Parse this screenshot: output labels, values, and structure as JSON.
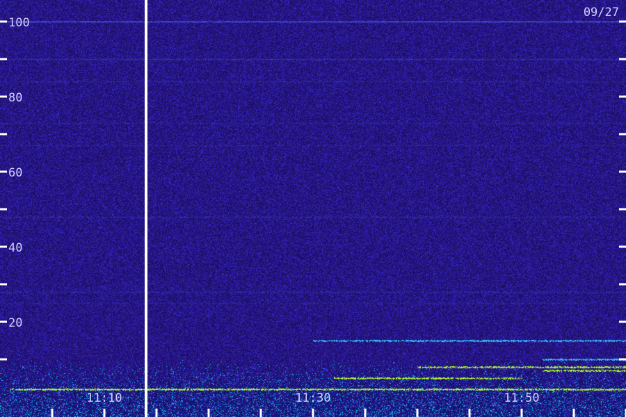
{
  "date_label": "09/27",
  "colors": {
    "background": "#1a0a4a",
    "noise_low": "#1c0c5c",
    "noise_high": "#3a2ad8",
    "band_cyan": "#30c8ff",
    "band_green": "#b0ff30",
    "marker": "#ffffff",
    "label": "#d0d0ff"
  },
  "chart_data": {
    "type": "heatmap",
    "title": "",
    "xlabel": "",
    "ylabel": "",
    "ylim": [
      0,
      105
    ],
    "xlim_minutes": [
      1,
      62
    ],
    "y_major_ticks": [
      100,
      80,
      60,
      40,
      20
    ],
    "y_minor_ticks": [
      90,
      70,
      50,
      30,
      10
    ],
    "x_tick_labels": [
      "11:10",
      "11:30",
      "11:50"
    ],
    "x_tick_minutes": [
      10,
      30,
      50
    ],
    "x_minor_tick_minutes": [
      5,
      15,
      20,
      25,
      35,
      40,
      45,
      55,
      60
    ],
    "marker_minute": 14,
    "horizontal_lines": [
      {
        "freq": 100,
        "strength": 0.8
      },
      {
        "freq": 90,
        "strength": 0.35
      },
      {
        "freq": 84,
        "strength": 0.2
      },
      {
        "freq": 73,
        "strength": 0.15
      },
      {
        "freq": 67,
        "strength": 0.15
      },
      {
        "freq": 48,
        "strength": 0.25
      },
      {
        "freq": 28,
        "strength": 0.25
      },
      {
        "freq": 25,
        "strength": 0.15
      }
    ],
    "low_bands": [
      {
        "freq": 15,
        "start_minute": 30,
        "end_minute": 62,
        "color": "cyan"
      },
      {
        "freq": 10,
        "start_minute": 52,
        "end_minute": 62,
        "color": "cyan"
      },
      {
        "freq": 8,
        "start_minute": 40,
        "end_minute": 60,
        "color": "green"
      },
      {
        "freq": 7,
        "start_minute": 52,
        "end_minute": 60,
        "color": "green"
      },
      {
        "freq": 5,
        "start_minute": 32,
        "end_minute": 50,
        "color": "green"
      },
      {
        "freq": 2,
        "start_minute": 1,
        "end_minute": 62,
        "color": "green"
      }
    ]
  }
}
